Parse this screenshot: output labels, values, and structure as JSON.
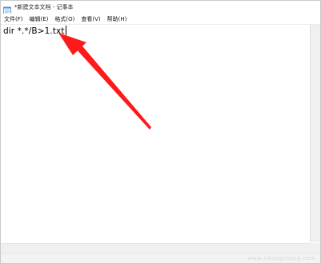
{
  "window": {
    "title": "*新建文本文档 - 记事本",
    "app_icon": "notepad-icon"
  },
  "menu": {
    "items": [
      {
        "label": "文件(F)"
      },
      {
        "label": "编辑(E)"
      },
      {
        "label": "格式(O)"
      },
      {
        "label": "查看(V)"
      },
      {
        "label": "帮助(H)"
      }
    ]
  },
  "editor": {
    "content": "dir *.*/B>1.txt"
  },
  "annotation": {
    "arrow_color": "#ff1a1a",
    "arrow_icon": "red-arrow-annotation"
  },
  "watermark": {
    "text": "www.xitongcheng.com"
  }
}
